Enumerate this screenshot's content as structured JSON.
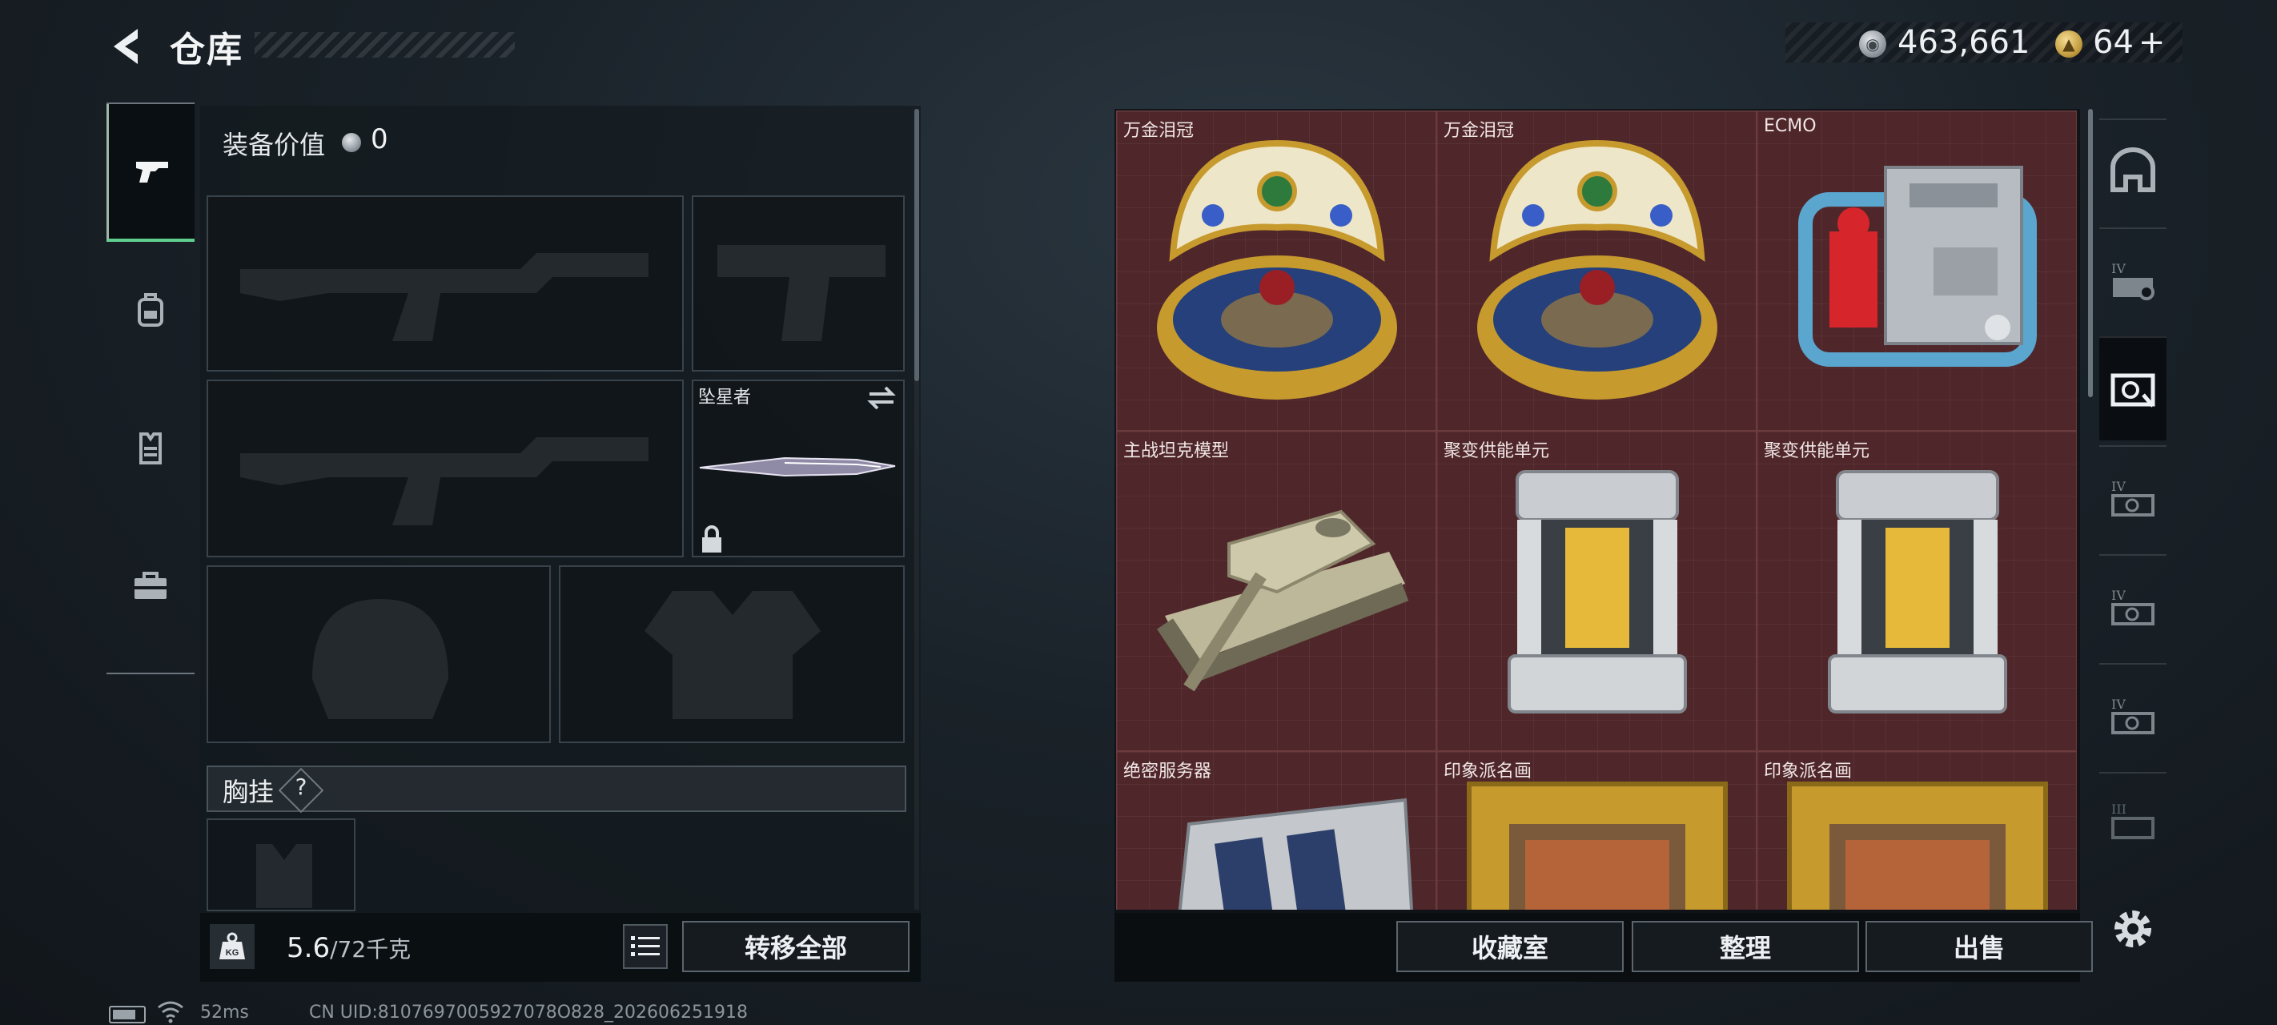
{
  "header": {
    "title": "仓库",
    "back_icon": "chevron-left-icon"
  },
  "currency": {
    "silver_value": "463,661",
    "gold_value": "64",
    "gold_plus": "+"
  },
  "left_tabs": [
    {
      "name": "pistol-icon",
      "active": true
    },
    {
      "name": "backpack-icon",
      "active": false
    },
    {
      "name": "vest-icon",
      "active": false
    },
    {
      "name": "toolbox-icon",
      "active": false
    }
  ],
  "equipment": {
    "value_label": "装备价值",
    "value": "0",
    "melee_name": "坠星者",
    "chest_label": "胸挂",
    "chest_help": "?"
  },
  "weight": {
    "current": "5.6",
    "max": "/72千克",
    "icon_text": "KG"
  },
  "buttons": {
    "transfer_all": "转移全部",
    "collection": "收藏室",
    "sort": "整理",
    "sell": "出售"
  },
  "items": [
    {
      "name": "万金泪冠",
      "icon": "jeweled-egg-icon"
    },
    {
      "name": "万金泪冠",
      "icon": "jeweled-egg-icon"
    },
    {
      "name": "ECMO",
      "icon": "ecmo-machine-icon"
    },
    {
      "name": "主战坦克模型",
      "icon": "tank-model-icon"
    },
    {
      "name": "聚变供能单元",
      "icon": "fusion-cell-icon"
    },
    {
      "name": "聚变供能单元",
      "icon": "fusion-cell-icon"
    },
    {
      "name": "绝密服务器",
      "icon": "server-icon"
    },
    {
      "name": "印象派名画",
      "icon": "framed-painting-icon"
    },
    {
      "name": "印象派名画",
      "icon": "framed-painting-icon"
    }
  ],
  "right_tabs": [
    {
      "name": "vault-icon",
      "label": ""
    },
    {
      "name": "case-iv-icon",
      "label": "IV"
    },
    {
      "name": "case-active-icon",
      "label": ""
    },
    {
      "name": "case-iv-icon",
      "label": "IV"
    },
    {
      "name": "case-iv-icon",
      "label": "IV"
    },
    {
      "name": "case-iv-icon",
      "label": "IV"
    },
    {
      "name": "case-iii-icon",
      "label": "III"
    }
  ],
  "status": {
    "ping": "52ms",
    "uid": "CN UID:8107697005927078O828_202606251918"
  },
  "colors": {
    "grid_bg": "#4f2629",
    "active_tab_line": "#5fcf8e",
    "panel_bg": "#141a1f"
  }
}
